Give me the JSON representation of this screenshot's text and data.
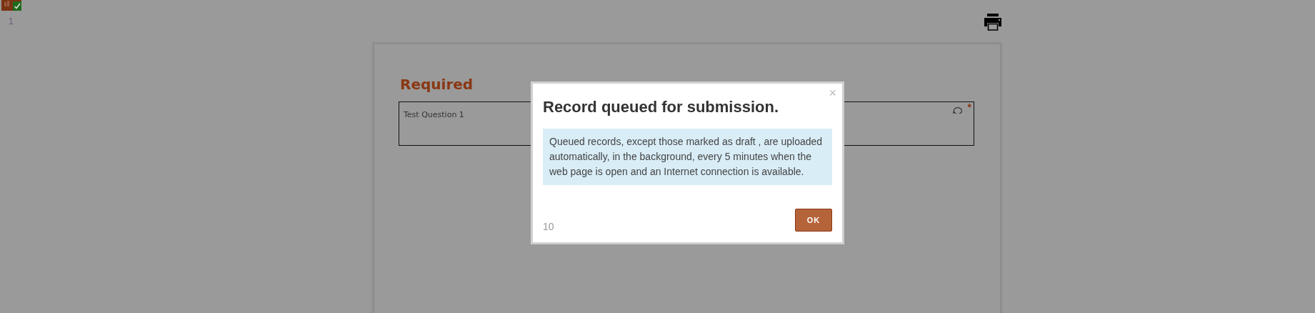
{
  "page_number": "1",
  "section": {
    "title": "Required",
    "questions": [
      {
        "label": "Test Question 1",
        "required_mark": "*"
      }
    ]
  },
  "dialog": {
    "title": "Record queued for submission.",
    "close": "×",
    "message": "Queued records, except those marked as draft , are uploaded automatically, in the background, every 5 minutes when the web page is open and an Internet connection is available.",
    "countdown": "10",
    "buttons": [
      "OK"
    ]
  }
}
